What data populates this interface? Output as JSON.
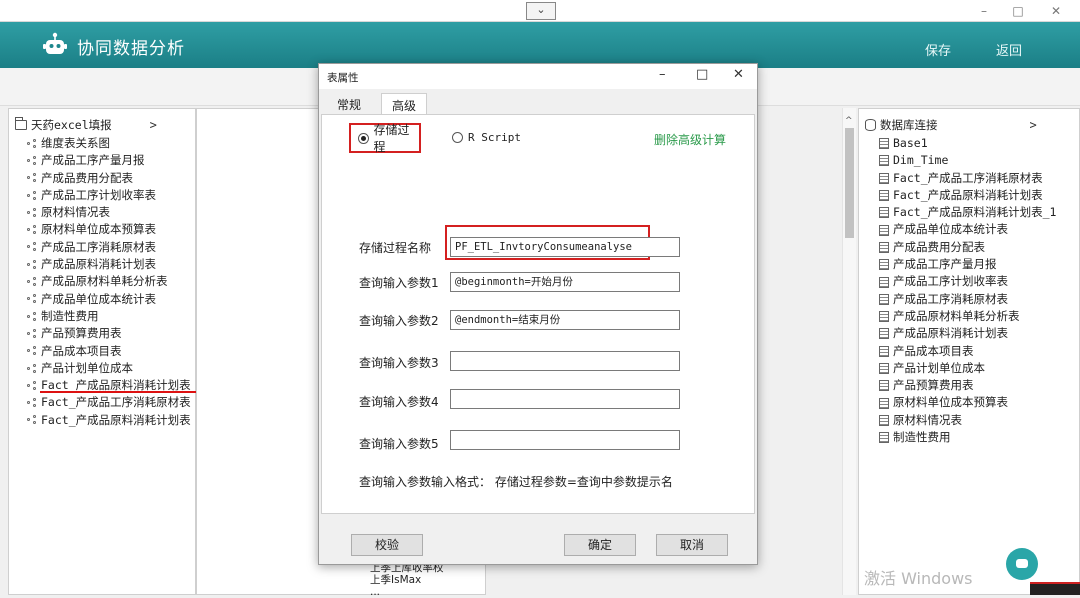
{
  "window": {
    "dropdown_glyph": "⌄",
    "min_glyph": "–",
    "max_glyph": "□",
    "close_glyph": "✕"
  },
  "header": {
    "title": "协同数据分析",
    "save": "保存",
    "back": "返回",
    "bg_color": "#1e878d"
  },
  "left_tree": {
    "root": "天药excel填报",
    "chevron": ">",
    "items": [
      "维度表关系图",
      "产成品工序产量月报",
      "产成品费用分配表",
      "产成品工序计划收率表",
      "原材料情况表",
      "原材料单位成本预算表",
      "产成品工序消耗原材表",
      "产成品原料消耗计划表",
      "产成品原材料单耗分析表",
      "产成品单位成本统计表",
      "制造性费用",
      "产品预算费用表",
      "产品成本项目表",
      "产品计划单位成本",
      "Fact_产成品原料消耗计划表",
      "Fact_产成品工序消耗原材表",
      "Fact_产成品原料消耗计划表"
    ]
  },
  "middle": {
    "lines": [
      "上季上库收率权",
      "上季IsMax",
      "..."
    ]
  },
  "right_tree": {
    "root": "数据库连接",
    "chevron": ">",
    "items": [
      "Base1",
      "Dim_Time",
      "Fact_产成品工序消耗原材表",
      "Fact_产成品原料消耗计划表",
      "Fact_产成品原料消耗计划表_1",
      "产成品单位成本统计表",
      "产成品费用分配表",
      "产成品工序产量月报",
      "产成品工序计划收率表",
      "产成品工序消耗原材表",
      "产成品原材料单耗分析表",
      "产成品原料消耗计划表",
      "产品成本项目表",
      "产品计划单位成本",
      "产品预算费用表",
      "原材料单位成本预算表",
      "原材料情况表",
      "制造性费用"
    ]
  },
  "watermark": "激活 Windows",
  "dialog": {
    "title": "表属性",
    "tabs": [
      "常规",
      "高级"
    ],
    "active_tab": "高级",
    "radio_sp": "存储过程",
    "radio_r": "R Script",
    "delete_link": "删除高级计算",
    "fields": [
      {
        "label": "存储过程名称",
        "value": "PF_ETL_InvtoryConsumeanalyse"
      },
      {
        "label": "查询输入参数1",
        "value": "@beginmonth=开始月份"
      },
      {
        "label": "查询输入参数2",
        "value": "@endmonth=结束月份"
      },
      {
        "label": "查询输入参数3",
        "value": ""
      },
      {
        "label": "查询输入参数4",
        "value": ""
      },
      {
        "label": "查询输入参数5",
        "value": ""
      }
    ],
    "hint": "查询输入参数输入格式：  存储过程参数=查询中参数提示名",
    "validate": "校验",
    "ok": "确定",
    "cancel": "取消",
    "highlight_color": "#d42020"
  }
}
